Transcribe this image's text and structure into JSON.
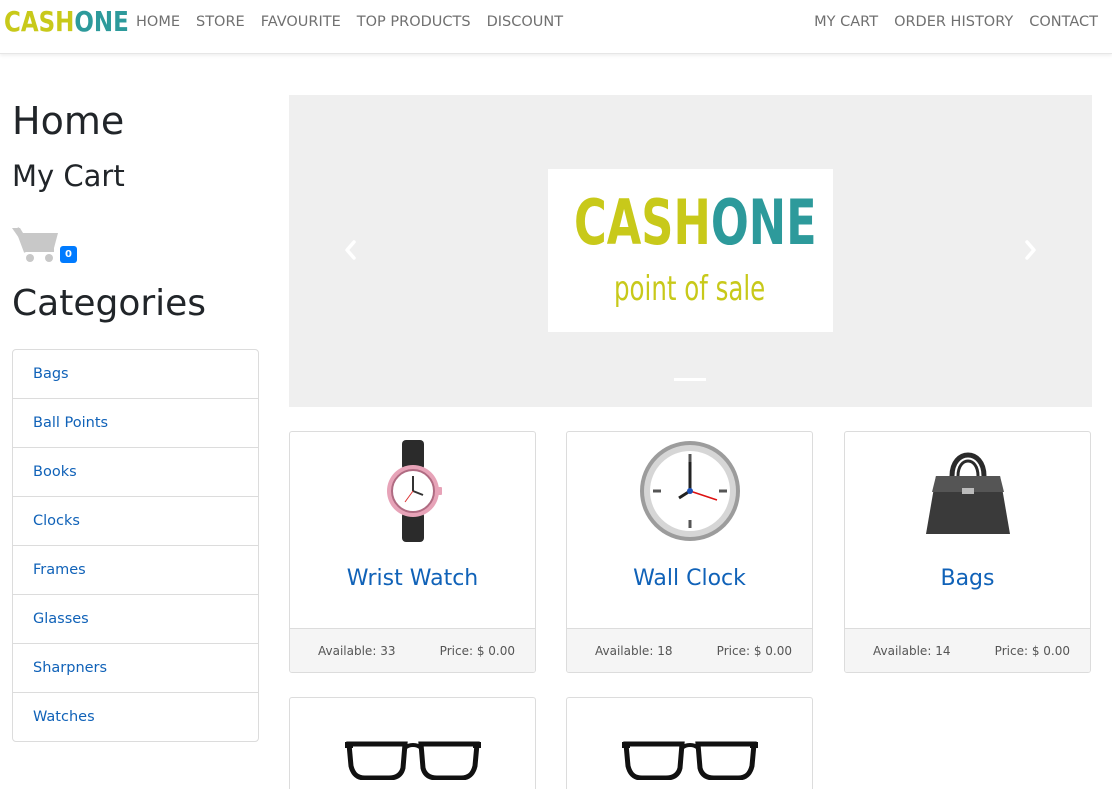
{
  "brand": {
    "part1": "CASH",
    "part2": "ONE"
  },
  "nav": {
    "left": [
      "HOME",
      "STORE",
      "FAVOURITE",
      "TOP PRODUCTS",
      "DISCOUNT"
    ],
    "right": [
      "MY CART",
      "ORDER HISTORY",
      "CONTACT"
    ]
  },
  "sidebar": {
    "home_heading": "Home",
    "cart_heading": "My Cart",
    "cart_count": "0",
    "categories_heading": "Categories",
    "categories": [
      "Bags",
      "Ball Points",
      "Books",
      "Clocks",
      "Frames",
      "Glasses",
      "Sharpners",
      "Watches"
    ]
  },
  "carousel": {
    "logo_part1": "CASH",
    "logo_part2": "ONE",
    "tagline": "point of sale"
  },
  "products": [
    {
      "name": "Wrist Watch",
      "available_label": "Available:",
      "available": "33",
      "price_label": "Price:",
      "price": "$ 0.00",
      "icon": "wrist-watch-icon"
    },
    {
      "name": "Wall Clock",
      "available_label": "Available:",
      "available": "18",
      "price_label": "Price:",
      "price": "$ 0.00",
      "icon": "wall-clock-icon"
    },
    {
      "name": "Bags",
      "available_label": "Available:",
      "available": "14",
      "price_label": "Price:",
      "price": "$ 0.00",
      "icon": "handbag-icon"
    },
    {
      "name": "",
      "icon": "glasses-icon"
    },
    {
      "name": "",
      "icon": "glasses-icon"
    }
  ],
  "colors": {
    "brand_yellow": "#c8c91a",
    "brand_teal": "#2d9a9b",
    "link_blue": "#1062b8",
    "badge_blue": "#007bff"
  }
}
